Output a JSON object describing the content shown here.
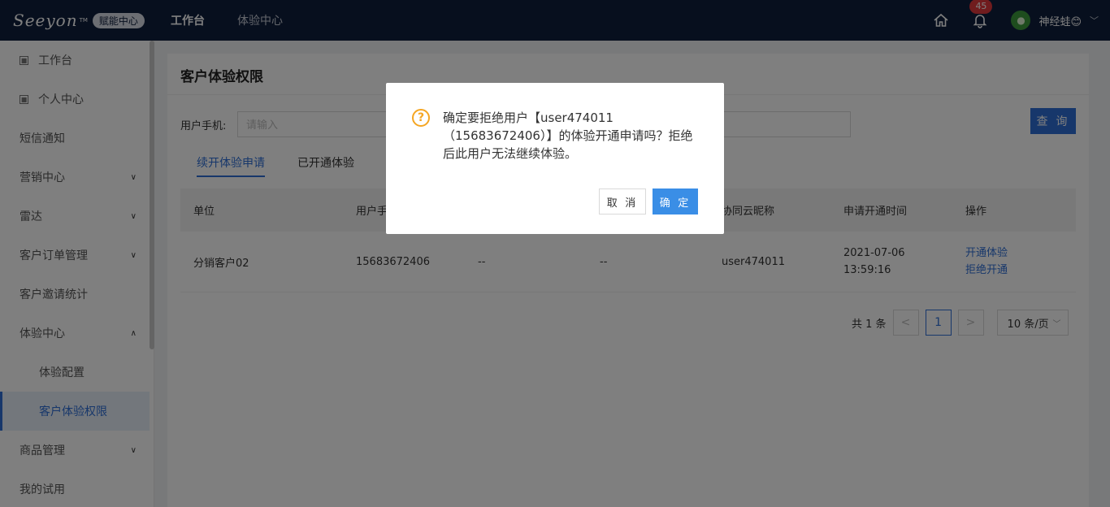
{
  "header": {
    "logo_text": "Seeyon",
    "logo_tm": "TM",
    "logo_badge": "赋能中心",
    "nav": [
      "工作台",
      "体验中心"
    ],
    "notification_count": "45",
    "username": "神经蛙😊"
  },
  "sidebar": {
    "items": [
      {
        "label": "工作台"
      },
      {
        "label": "个人中心"
      },
      {
        "label": "短信通知"
      },
      {
        "label": "营销中心"
      },
      {
        "label": "雷达"
      },
      {
        "label": "客户订单管理"
      },
      {
        "label": "客户邀请统计"
      },
      {
        "label": "体验中心"
      },
      {
        "label": "体验配置"
      },
      {
        "label": "客户体验权限"
      },
      {
        "label": "商品管理"
      },
      {
        "label": "我的试用"
      }
    ]
  },
  "main": {
    "title": "客户体验权限",
    "filter_label": "用户手机:",
    "filter_placeholder": "请输入",
    "query_button": "查 询",
    "tabs": [
      "续开体验申请",
      "已开通体验"
    ],
    "columns": [
      "单位",
      "用户手",
      "",
      "",
      "协同云昵称",
      "申请开通时间",
      "操作"
    ],
    "rows": [
      {
        "unit": "分销客户02",
        "phone": "15683672406",
        "col3": "--",
        "col4": "--",
        "nickname": "user474011",
        "time_date": "2021-07-06",
        "time_clock": "13:59:16",
        "action_open": "开通体验",
        "action_reject": "拒绝开通"
      }
    ],
    "pagination": {
      "total": "共 1 条",
      "prev": "<",
      "current": "1",
      "next": ">",
      "page_size": "10 条/页"
    }
  },
  "dialog": {
    "message": "确定要拒绝用户【user474011（15683672406）】的体验开通申请吗？拒绝后此用户无法继续体验。",
    "cancel": "取 消",
    "ok": "确 定"
  },
  "colors": {
    "topbar": "#0f1e3c",
    "accent": "#2f6fd6",
    "warning": "#f5a623",
    "badge": "#e0383c"
  }
}
